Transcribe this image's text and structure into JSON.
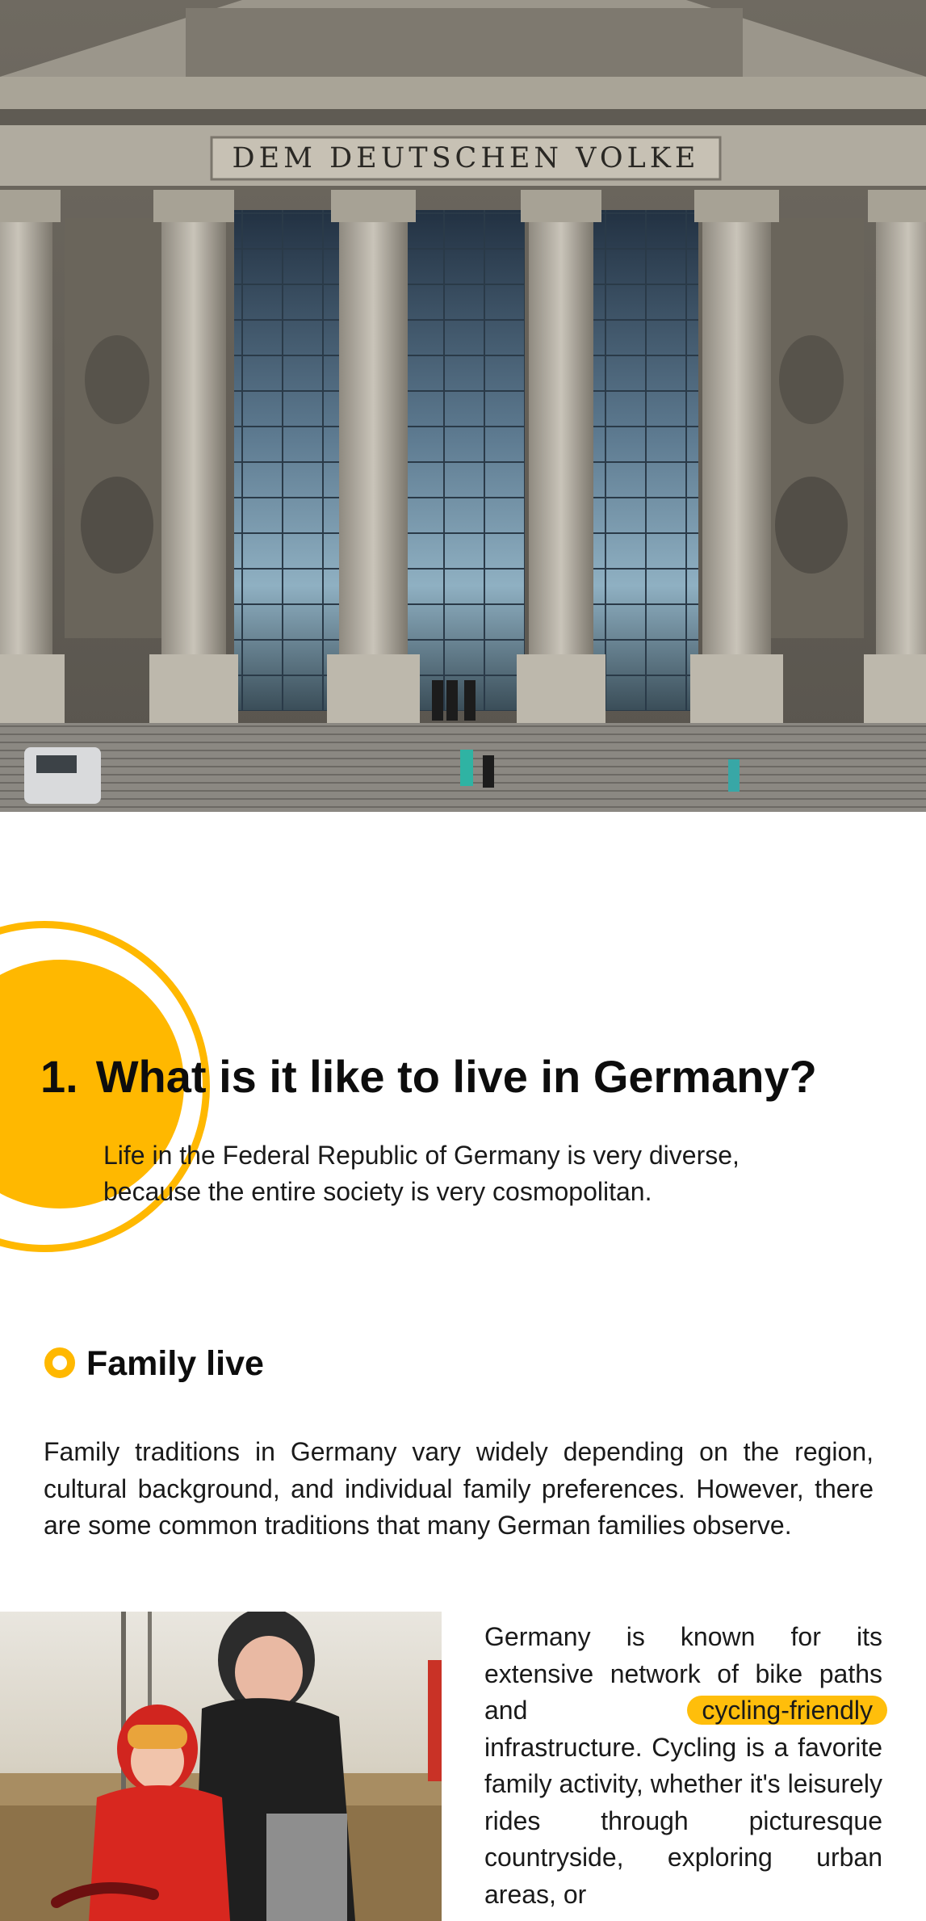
{
  "hero": {
    "inscription": "Dem Deutschen Volke",
    "image": "reichstag-building-photo"
  },
  "section": {
    "number": "1.",
    "title": "What is it like to live in Germany?",
    "lead": "Life in the Federal Republic of Germany is very diverse, because the entire society is very cosmopolitan."
  },
  "subsection": {
    "title": "Family live",
    "paragraph": "Family traditions in Germany vary widely depending on the region, cultural background, and individual family preferences. However, there are some common traditions that many German families observe."
  },
  "side": {
    "text_before": "Germany is known for its extensive network of bike paths and ",
    "highlight": "cycling-friendly",
    "text_after": " infrastructure. Cycling is a favorite family activity, whether it's leisurely rides through picturesque countryside, exploring urban areas, or",
    "image": "father-and-child-cycling-photo"
  },
  "colors": {
    "accent": "#ffb800",
    "text": "#111111",
    "background": "#ffffff"
  }
}
